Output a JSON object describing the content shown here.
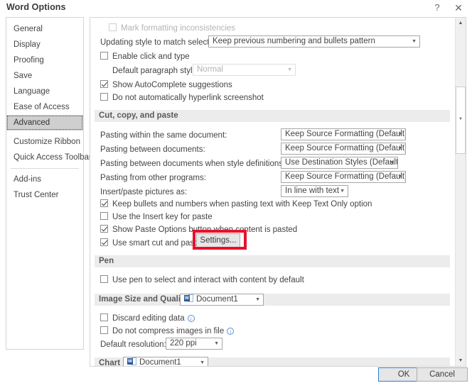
{
  "window": {
    "title": "Word Options",
    "help_icon": "question-mark-icon",
    "close_icon": "close-x-icon"
  },
  "sidebar": {
    "items": [
      {
        "label": "General",
        "selected": false
      },
      {
        "label": "Display",
        "selected": false
      },
      {
        "label": "Proofing",
        "selected": false
      },
      {
        "label": "Save",
        "selected": false
      },
      {
        "label": "Language",
        "selected": false
      },
      {
        "label": "Ease of Access",
        "selected": false
      },
      {
        "label": "Advanced",
        "selected": true
      },
      {
        "label": "Customize Ribbon",
        "selected": false
      },
      {
        "label": "Quick Access Toolbar",
        "selected": false
      },
      {
        "label": "Add-ins",
        "selected": false
      },
      {
        "label": "Trust Center",
        "selected": false
      }
    ]
  },
  "editing": {
    "mark_formatting_inconsistencies": "Mark formatting inconsistencies",
    "updating_style_label": "Updating style to match selection:",
    "updating_style_value": "Keep previous numbering and bullets pattern",
    "enable_click_and_type": "Enable click and type",
    "default_paragraph_style_label": "Default paragraph style:",
    "default_paragraph_style_value": "Normal",
    "show_autocomplete": "Show AutoComplete suggestions",
    "do_not_hyperlink_screenshot": "Do not automatically hyperlink screenshot"
  },
  "cut_copy_paste": {
    "heading": "Cut, copy, and paste",
    "rows": [
      {
        "label": "Pasting within the same document:",
        "value": "Keep Source Formatting (Default)"
      },
      {
        "label": "Pasting between documents:",
        "value": "Keep Source Formatting (Default)"
      },
      {
        "label": "Pasting between documents when style definitions conflict:",
        "value": "Use Destination Styles (Default)"
      },
      {
        "label": "Pasting from other programs:",
        "value": "Keep Source Formatting (Default)"
      },
      {
        "label": "Insert/paste pictures as:",
        "value": "In line with text"
      }
    ],
    "keep_bullets": "Keep bullets and numbers when pasting text with Keep Text Only option",
    "use_insert_key": "Use the Insert key for paste",
    "show_paste_options": "Show Paste Options button when content is pasted",
    "use_smart_cut_paste": "Use smart cut and paste",
    "settings_button": "Settings...",
    "annotation_color": "#e8112d"
  },
  "pen": {
    "heading": "Pen",
    "use_pen": "Use pen to select and interact with content by default"
  },
  "image_size_quality": {
    "heading": "Image Size and Quality",
    "scope_value": "Document1",
    "discard_editing_data": "Discard editing data",
    "do_not_compress": "Do not compress images in file",
    "default_resolution_label": "Default resolution:",
    "default_resolution_value": "220 ppi"
  },
  "chart": {
    "heading": "Chart",
    "scope_value": "Document1"
  },
  "footer": {
    "ok_label": "OK",
    "cancel_label": "Cancel"
  }
}
